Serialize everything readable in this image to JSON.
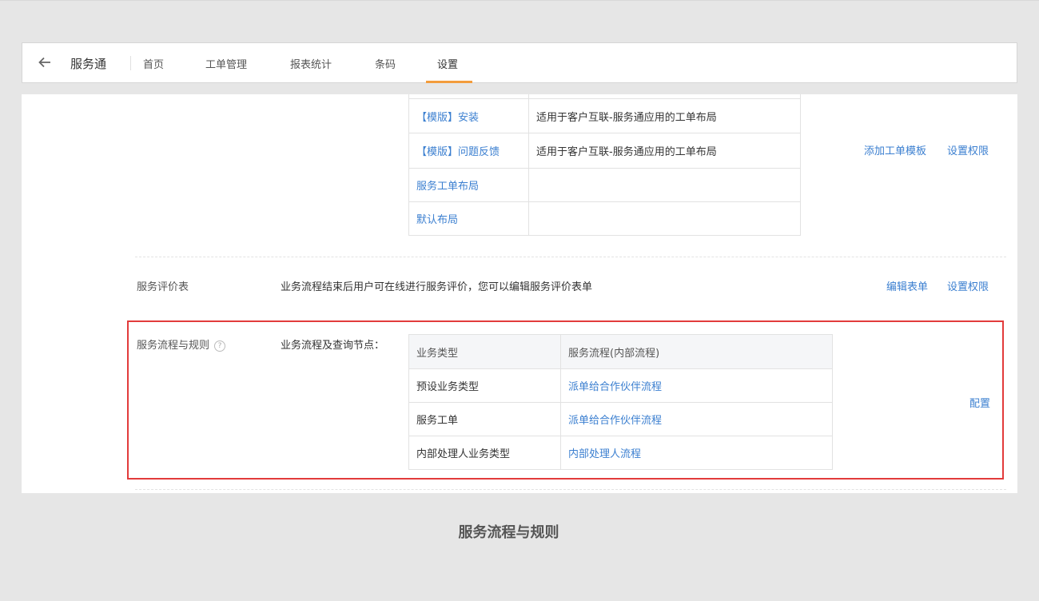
{
  "nav": {
    "app_name": "服务通",
    "tabs": [
      "首页",
      "工单管理",
      "报表统计",
      "条码",
      "设置"
    ],
    "active_tab": "设置",
    "accent_color": "#f39c3c"
  },
  "templates": {
    "rows": [
      {
        "name": "【模版】安装",
        "desc": "适用于客户互联-服务通应用的工单布局"
      },
      {
        "name": "【模版】问题反馈",
        "desc": "适用于客户互联-服务通应用的工单布局"
      },
      {
        "name": "服务工单布局",
        "desc": ""
      },
      {
        "name": "默认布局",
        "desc": ""
      }
    ],
    "actions": {
      "add": "添加工单模板",
      "permissions": "设置权限"
    }
  },
  "evaluation": {
    "label": "服务评价表",
    "description": "业务流程结束后用户可在线进行服务评价，您可以编辑服务评价表单",
    "actions": {
      "edit": "编辑表单",
      "permissions": "设置权限"
    }
  },
  "flow_rules": {
    "label": "服务流程与规则",
    "sub_label": "业务流程及查询节点：",
    "columns": [
      "业务类型",
      "服务流程(内部流程)"
    ],
    "rows": [
      {
        "type": "预设业务类型",
        "flow": "派单给合作伙伴流程"
      },
      {
        "type": "服务工单",
        "flow": "派单给合作伙伴流程"
      },
      {
        "type": "内部处理人业务类型",
        "flow": "内部处理人流程"
      }
    ],
    "action": "配置",
    "highlight_color": "#e23b3b"
  },
  "caption": "服务流程与规则"
}
